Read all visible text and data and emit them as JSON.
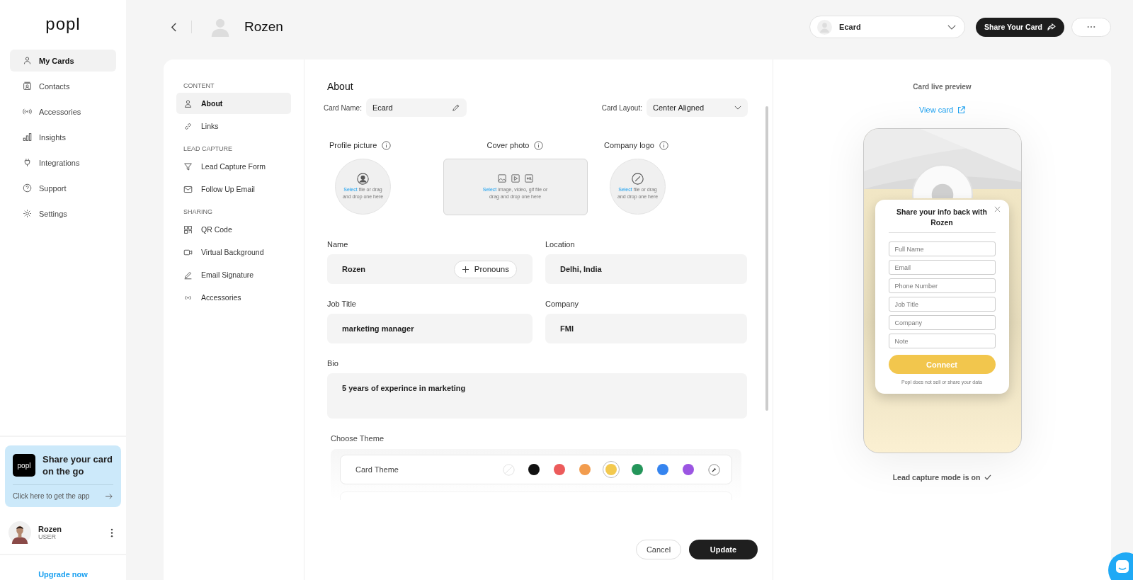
{
  "sidebar": {
    "logo": "popl",
    "nav": [
      {
        "label": "My Cards",
        "selected": true
      },
      {
        "label": "Contacts",
        "selected": false
      },
      {
        "label": "Accessories",
        "selected": false
      },
      {
        "label": "Insights",
        "selected": false
      },
      {
        "label": "Integrations",
        "selected": false
      },
      {
        "label": "Support",
        "selected": false
      },
      {
        "label": "Settings",
        "selected": false
      }
    ],
    "promo": {
      "logo": "popl",
      "title": "Share your card on the go",
      "link": "Click here to get the app"
    },
    "user": {
      "name": "Rozen",
      "role": "USER"
    },
    "upgrade": "Upgrade now"
  },
  "header": {
    "title": "Rozen",
    "card_select": "Ecard",
    "share_button": "Share Your Card"
  },
  "settings_nav": [
    {
      "heading": "CONTENT",
      "items": [
        {
          "label": "About",
          "selected": true
        },
        {
          "label": "Links",
          "selected": false
        }
      ]
    },
    {
      "heading": "LEAD CAPTURE",
      "items": [
        {
          "label": "Lead Capture Form",
          "selected": false
        },
        {
          "label": "Follow Up Email",
          "selected": false
        }
      ]
    },
    {
      "heading": "SHARING",
      "items": [
        {
          "label": "QR Code",
          "selected": false
        },
        {
          "label": "Virtual Background",
          "selected": false
        },
        {
          "label": "Email Signature",
          "selected": false
        },
        {
          "label": "Accessories",
          "selected": false
        }
      ]
    }
  ],
  "about": {
    "title": "About",
    "card_name_label": "Card Name:",
    "card_name": "Ecard",
    "layout_label": "Card Layout:",
    "layout": "Center Aligned",
    "uploads": [
      {
        "kind": "profile",
        "label": "Profile picture",
        "link": "Select",
        "hint": "file or drag and drop one here"
      },
      {
        "kind": "cover",
        "label": "Cover photo",
        "link": "Select",
        "hint": "image, video, gif file or drag and drop one here"
      },
      {
        "kind": "logo",
        "label": "Company logo",
        "link": "Select",
        "hint": "file or drag and drop one here"
      }
    ],
    "fields": [
      {
        "label": "Name",
        "value": "Rozen",
        "action": "Pronouns"
      },
      {
        "label": "Location",
        "value": "Delhi, India"
      },
      {
        "label": "Job Title",
        "value": "marketing manager"
      },
      {
        "label": "Company",
        "value": "FMI"
      }
    ],
    "bio": {
      "label": "Bio",
      "value": "5 years of experince in marketing"
    },
    "theme": {
      "heading": "Choose Theme",
      "label": "Card Theme",
      "swatches": [
        {
          "kind": "none",
          "selected": false
        },
        {
          "kind": "color",
          "color": "#111111",
          "selected": false
        },
        {
          "kind": "color",
          "color": "#ec5b5b",
          "selected": false
        },
        {
          "kind": "color",
          "color": "#f29c4e",
          "selected": false
        },
        {
          "kind": "color",
          "color": "#f3c94f",
          "selected": true
        },
        {
          "kind": "color",
          "color": "#24955a",
          "selected": false
        },
        {
          "kind": "color",
          "color": "#3584ef",
          "selected": false
        },
        {
          "kind": "color",
          "color": "#9b55e2",
          "selected": false
        },
        {
          "kind": "picker",
          "selected": false
        }
      ]
    },
    "cancel": "Cancel",
    "update": "Update"
  },
  "preview": {
    "title": "Card live preview",
    "view_link": "View card",
    "modal": {
      "title": "Share your info back with Rozen",
      "placeholders": [
        "Full Name",
        "Email",
        "Phone Number",
        "Job Title",
        "Company",
        "Note"
      ],
      "button": "Connect",
      "note": "Popl does not sell or share your data"
    },
    "status": "Lead capture mode is on"
  }
}
